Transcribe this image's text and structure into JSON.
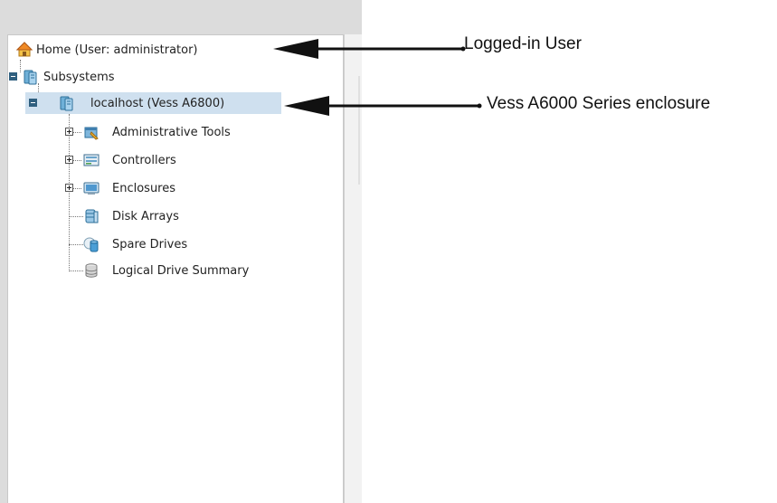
{
  "tree": {
    "home": {
      "label": "Home (User: administrator)",
      "icon": "home-icon"
    },
    "subsystems": {
      "label": "Subsystems",
      "icon": "server-icon"
    },
    "localhost": {
      "label": "localhost (Vess A6800)",
      "icon": "server-icon"
    },
    "children": [
      {
        "label": "Administrative Tools",
        "icon": "admin-tools-icon",
        "expandable": true
      },
      {
        "label": "Controllers",
        "icon": "controller-icon",
        "expandable": true
      },
      {
        "label": "Enclosures",
        "icon": "enclosure-icon",
        "expandable": true
      },
      {
        "label": "Disk Arrays",
        "icon": "disk-array-icon",
        "expandable": false
      },
      {
        "label": "Spare Drives",
        "icon": "spare-drive-icon",
        "expandable": false
      },
      {
        "label": "Logical Drive Summary",
        "icon": "logical-drive-icon",
        "expandable": false
      }
    ]
  },
  "annotations": {
    "logged_in_user": "Logged-in User",
    "enclosure_series": "Vess A6000  Series enclosure"
  },
  "colors": {
    "selection": "#cfe0ef",
    "pane_background": "#dcdcdc"
  }
}
